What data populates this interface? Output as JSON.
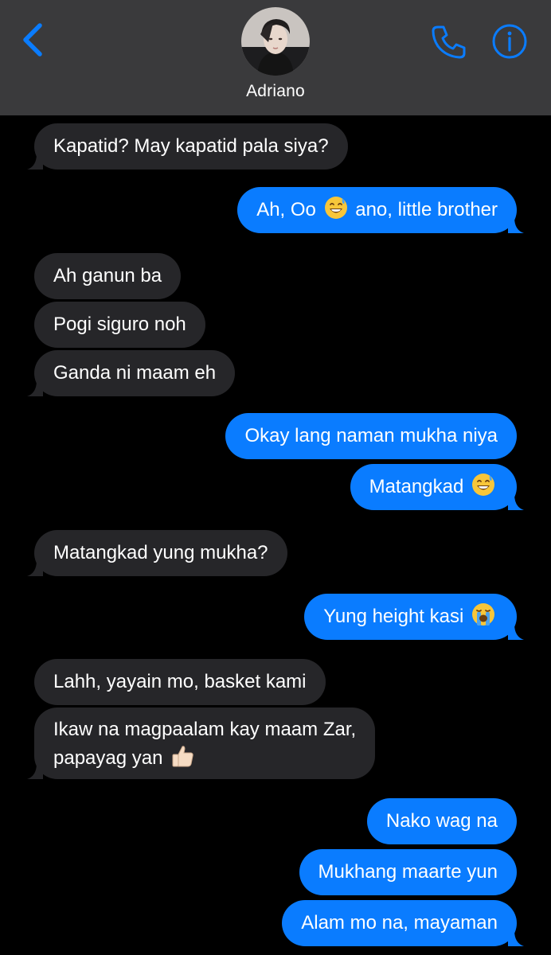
{
  "header": {
    "contact_name": "Adriano",
    "back_icon": "chevron-left-icon",
    "call_icon": "phone-icon",
    "info_icon": "info-icon",
    "accent_color": "#0a7cff"
  },
  "messages": [
    {
      "side": "in",
      "text": "Kapatid? May kapatid pala siya?"
    },
    {
      "side": "out",
      "text_before": "Ah, Oo ",
      "emoji": "grinning-sweat-emoji",
      "text_after": " ano, little brother"
    },
    {
      "side": "in",
      "text": "Ah ganun ba"
    },
    {
      "side": "in",
      "text": "Pogi siguro noh"
    },
    {
      "side": "in",
      "text": "Ganda ni maam eh"
    },
    {
      "side": "out",
      "text": "Okay lang naman mukha niya"
    },
    {
      "side": "out",
      "text_before": "Matangkad ",
      "emoji": "grinning-sweat-emoji"
    },
    {
      "side": "in",
      "text": "Matangkad yung mukha?"
    },
    {
      "side": "out",
      "text_before": "Yung height kasi ",
      "emoji": "loudly-crying-emoji"
    },
    {
      "side": "in",
      "text": "Lahh, yayain mo, basket kami"
    },
    {
      "side": "in",
      "line1": "Ikaw na magpaalam kay maam Zar,",
      "line2_before": "papayag yan ",
      "emoji": "thumbs-up-emoji"
    },
    {
      "side": "out",
      "text": "Nako wag na"
    },
    {
      "side": "out",
      "text": "Mukhang maarte yun"
    },
    {
      "side": "out",
      "text": "Alam mo na, mayaman"
    }
  ],
  "colors": {
    "incoming_bubble": "#262629",
    "outgoing_bubble": "#0a7cff",
    "background": "#000000",
    "header": "#3a3a3c"
  }
}
